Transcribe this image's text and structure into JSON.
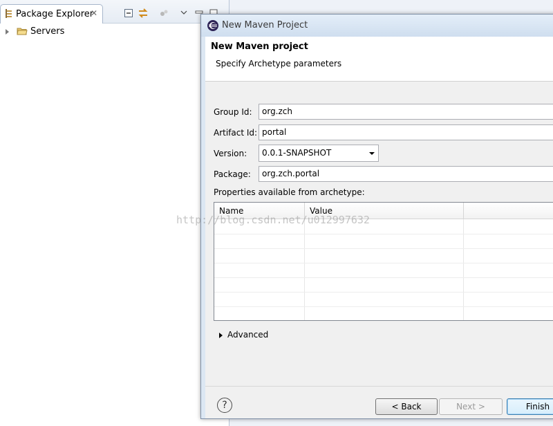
{
  "explorer": {
    "tab_title": "Package Explorer",
    "tab_close": "✕",
    "tree": [
      {
        "label": "Servers",
        "icon": "folder-icon"
      }
    ]
  },
  "dialog": {
    "title": "New Maven Project",
    "header_title": "New Maven project",
    "header_desc": "Specify Archetype parameters",
    "fields": {
      "group_label": "Group Id:",
      "group_value": "org.zch",
      "artifact_label": "Artifact Id:",
      "artifact_value": "portal",
      "version_label": "Version:",
      "version_value": "0.0.1-SNAPSHOT",
      "package_label": "Package:",
      "package_value": "org.zch.portal"
    },
    "properties_label": "Properties available from archetype:",
    "table": {
      "columns": [
        "Name",
        "Value"
      ],
      "rows": []
    },
    "advanced_label": "Advanced",
    "buttons": {
      "help": "?",
      "back": "< Back",
      "next": "Next >",
      "finish": "Finish"
    }
  },
  "watermark": "http://blog.csdn.net/u012997632",
  "colors": {
    "titlebar": "#cfdeef",
    "dialog_bg": "#f0f0f0",
    "accent": "#3c7fb1"
  }
}
